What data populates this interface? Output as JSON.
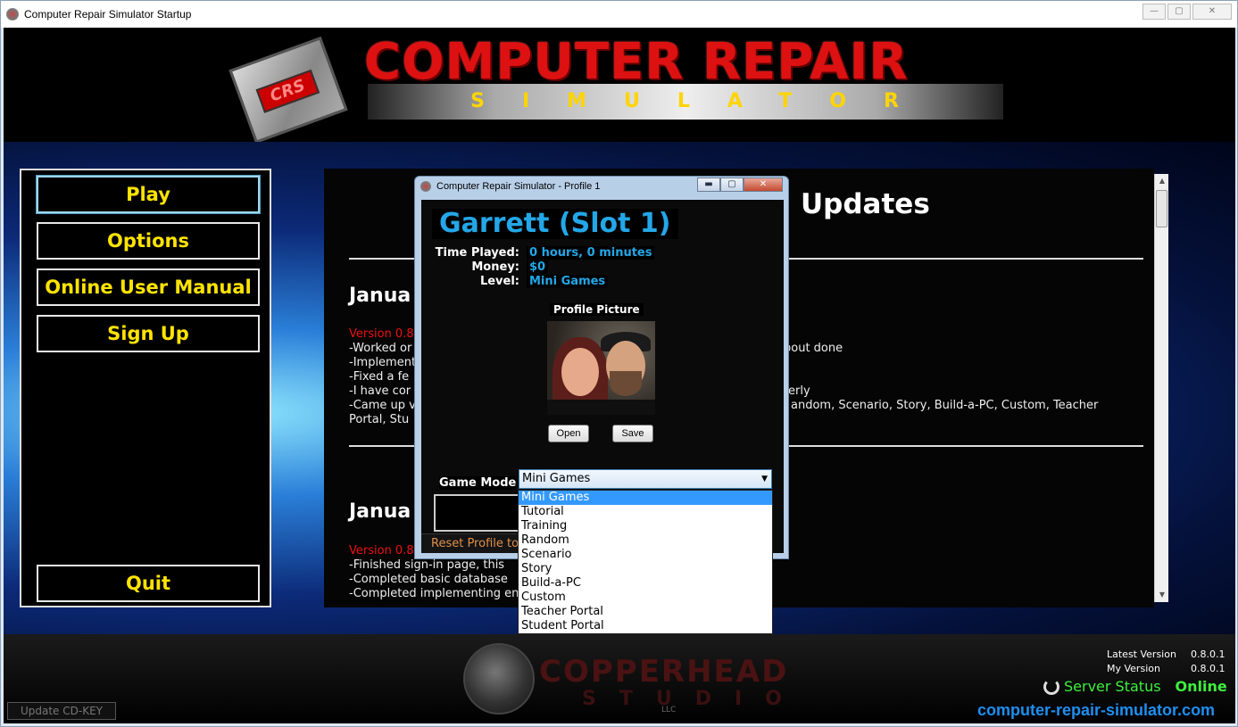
{
  "window": {
    "title": "Computer Repair Simulator Startup",
    "buttons": {
      "minimize": "—",
      "maximize": "▢",
      "close": "✕"
    }
  },
  "header": {
    "logo_chip": "CRS",
    "title": "COMPUTER REPAIR",
    "subtitle": "SIMULATOR"
  },
  "nav": {
    "play": "Play",
    "options": "Options",
    "manual": "Online User Manual",
    "signup": "Sign Up",
    "quit": "Quit"
  },
  "news": {
    "heading": "Updates",
    "entries": [
      {
        "date": "Janua",
        "version": "Version 0.8",
        "lines": [
          "-Worked or",
          "-Implement",
          "-Fixed a fe",
          "-I have cor",
          "-Came up v",
          "Portal, Stu"
        ],
        "tails": [
          "bout done",
          "erly",
          "andom, Scenario, Story, Build-a-PC, Custom, Teacher"
        ]
      },
      {
        "date": "Janua",
        "version": "Version 0.8",
        "lines": [
          "-Finished sign-in page, this",
          "-Completed basic database",
          "-Completed implementing en"
        ]
      }
    ]
  },
  "profile_dialog": {
    "title": "Computer Repair Simulator - Profile 1",
    "buttons": {
      "minimize": "▬",
      "maximize": "▢",
      "close": "✕"
    },
    "name": "Garrett (Slot 1)",
    "stats": {
      "time_label": "Time Played:",
      "time_value": "0 hours, 0 minutes",
      "money_label": "Money:",
      "money_value": "$0",
      "level_label": "Level:",
      "level_value": "Mini Games"
    },
    "picture_label": "Profile Picture",
    "open_label": "Open",
    "save_label": "Save",
    "game_mode_label": "Game Mode",
    "game_mode_value": "Mini Games",
    "reset_label": "Reset Profile to"
  },
  "game_mode_options": [
    "Mini Games",
    "Tutorial",
    "Training",
    "Random",
    "Scenario",
    "Story",
    "Build-a-PC",
    "Custom",
    "Teacher Portal",
    "Student Portal"
  ],
  "footer": {
    "studio_name": "COPPERHEAD",
    "studio_sub": "STUDIO",
    "studio_llc": "LLC",
    "latest_version_label": "Latest Version",
    "latest_version_value": "0.8.0.1",
    "my_version_label": "My Version",
    "my_version_value": "0.8.0.1",
    "server_status_label": "Server Status",
    "server_status_value": "Online",
    "website": "computer-repair-simulator.com",
    "cdkey_button": "Update CD-KEY"
  }
}
